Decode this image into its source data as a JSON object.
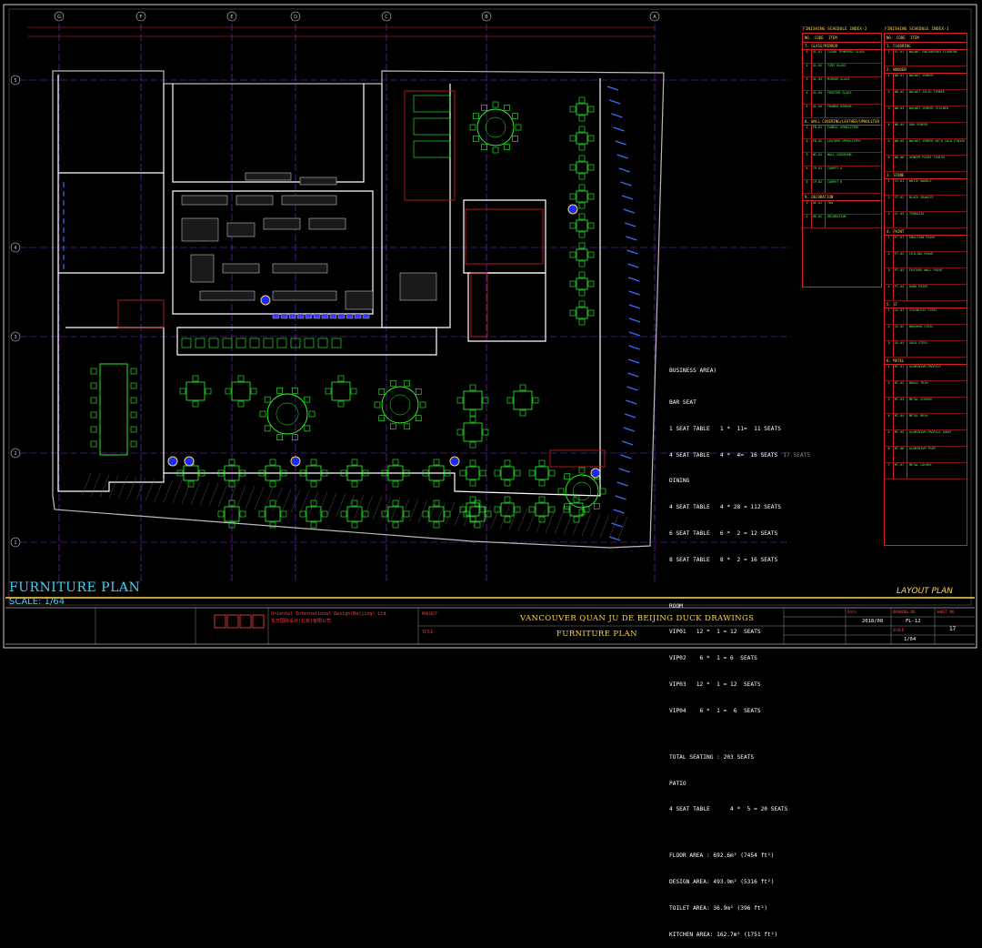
{
  "sheet": {
    "title": "FURNITURE PLAN",
    "scale": "SCALE: 1/64",
    "layout_plan": "LAYOUT PLAN",
    "grid_columns": [
      "G",
      "F",
      "E",
      "D",
      "C",
      "B",
      "A"
    ],
    "grid_rows": [
      "5",
      "4",
      "3",
      "2",
      "1"
    ]
  },
  "stats": {
    "business_area": "BUSINESS AREA)",
    "bar_seat": "BAR SEAT",
    "bar_1": "1 SEAT TABLE   1 *  11=  11 SEATS",
    "bar_4": "4 SEAT TABLE   4 *  4=  16 SEATS",
    "bar_note": "17 SEATS",
    "dining": "DINING",
    "dining_4": "4 SEAT TABLE   4 * 28 = 112 SEATS",
    "dining_6": "6 SEAT TABLE   6 *  2 = 12 SEATS",
    "dining_8": "8 SEAT TABLE   8 *  2 = 16 SEATS",
    "room": "ROOM",
    "vip01": "VIP01   12 *  1 = 12  SEATS",
    "vip02": "VIP02    6 *  1 = 6  SEATS",
    "vip03": "VIP03   12 *  1 = 12  SEATS",
    "vip04": "VIP04    6 *  1 =  6  SEATS",
    "total": "TOTAL SEATING : 203 SEATS",
    "patio": "PATIO",
    "patio_4": "4 SEAT TABLE      4 *  5 = 20 SEATS",
    "floor_area": "FLOOR AREA : 692.6m² (7454 ft²)",
    "design_area": "DESIGN AREA: 493.9m² (5316 ft²)",
    "toilet_area": "TOILET AREA: 36.9m² (396 ft²)",
    "kitchen_area": "KITCHEN AREA: 162.7m² (1751 ft²)"
  },
  "schedule_2": {
    "title": "FINISHING SCHEDULE INDEX-2",
    "col_no": "NO.",
    "col_code": "CODE",
    "col_desc": "ITEM",
    "sections": [
      {
        "name": "7. GLASS/MIRROR",
        "rows": [
          [
            "1",
            "GL-01",
            "CLEAR TEMPERED GLASS"
          ],
          [
            "2",
            "GL-02",
            "TINT GLASS"
          ],
          [
            "3",
            "GL-03",
            "MIRROR GLASS"
          ],
          [
            "4",
            "GL-04",
            "FROSTED GLASS"
          ],
          [
            "5",
            "GL-05",
            "FRAMED MIRROR"
          ]
        ]
      },
      {
        "name": "8. WALL COVERING/LEATHER/UPHOLSTER",
        "rows": [
          [
            "1",
            "FB-01",
            "FABRIC UPHOLSTERY"
          ],
          [
            "2",
            "FB-02",
            "LEATHER UPHOLSTERY"
          ],
          [
            "3",
            "WC-01",
            "WALL COVERING"
          ],
          [
            "4",
            "CP-01",
            "CARPET A"
          ],
          [
            "5",
            "CP-02",
            "CARPET B"
          ]
        ]
      },
      {
        "name": "9. DECORATION",
        "rows": [
          [
            "1",
            "DE-01",
            "TBA"
          ],
          [
            "2",
            "DE-02",
            "DECORATION"
          ]
        ]
      }
    ]
  },
  "schedule_1": {
    "title": "FINISHING SCHEDULE INDEX-1",
    "col_no": "NO.",
    "col_code": "CODE",
    "col_desc": "ITEM",
    "sections": [
      {
        "name": "1. FLOORING",
        "rows": [
          [
            "1",
            "FL-01",
            "WALNUT ENGINEERED FLOORING"
          ]
        ]
      },
      {
        "name": "2. WOODEN",
        "rows": [
          [
            "1",
            "WD-01",
            "WALNUT VENEER"
          ],
          [
            "2",
            "WD-02",
            "WALNUT SOLID TIMBER"
          ],
          [
            "3",
            "WD-03",
            "WALNUT VENEER STAINED"
          ],
          [
            "4",
            "WD-04",
            "OAK VENEER"
          ],
          [
            "5",
            "WD-05",
            "WALNUT VENEER WITH GOLD FINISH"
          ],
          [
            "6",
            "WD-06",
            "VENEER PAINT FINISH"
          ]
        ]
      },
      {
        "name": "3. STONE",
        "rows": [
          [
            "1",
            "ST-01",
            "WHITE MARBLE"
          ],
          [
            "2",
            "ST-02",
            "BLACK GRANITE"
          ],
          [
            "3",
            "ST-03",
            "TERRAZZO"
          ]
        ]
      },
      {
        "name": "4. PAINT",
        "rows": [
          [
            "1",
            "PT-01",
            "EMULSION PAINT"
          ],
          [
            "2",
            "PT-02",
            "CEILING PAINT"
          ],
          [
            "3",
            "PT-03",
            "FEATURE WALL PAINT"
          ],
          [
            "4",
            "PT-04",
            "DARK PAINT"
          ]
        ]
      },
      {
        "name": "5. ST",
        "rows": [
          [
            "1",
            "SS-01",
            "STAINLESS STEEL"
          ],
          [
            "2",
            "SS-02",
            "BRUSHED STEEL"
          ],
          [
            "3",
            "SS-03",
            "GOLD STEEL"
          ]
        ]
      },
      {
        "name": "6. MATEL",
        "rows": [
          [
            "1",
            "MT-01",
            "ALUMINIUM PROFILE"
          ],
          [
            "2",
            "MT-02",
            "BRASS TRIM"
          ],
          [
            "3",
            "MT-03",
            "METAL SCREEN"
          ],
          [
            "4",
            "MT-04",
            "METAL MESH"
          ],
          [
            "5",
            "MT-05",
            "ALUMINIUM PROFILE SHEET"
          ],
          [
            "6",
            "MT-06",
            "ALUMINIUM TRIM"
          ],
          [
            "7",
            "MT-07",
            "METAL LOUVRE"
          ]
        ]
      }
    ]
  },
  "title_block": {
    "company_cn": "Oriental International Design(Beijing) Ltd.",
    "company_cn_2": "东方国际设计(北京)有限公司",
    "project": "VANCOUVER QUAN JU DE BEIJING DUCK  DRAWINGS",
    "drawing": "FURNITURE PLAN",
    "date": "2018/08",
    "scale": "1/64",
    "sheet_no": "FL-12",
    "page": "17",
    "label_project": "PROJECT",
    "label_title": "TITLE",
    "label_date": "Date",
    "label_scale": "SCALE",
    "label_dwg": "DRAWING NO.",
    "label_sheet": "SHEET NO."
  },
  "colors": {
    "grid": "#8a2be2",
    "wall": "#ffffff",
    "table": "#2bff2b",
    "chair": "#2bff2b",
    "window": "#3a6cff",
    "outline": "#d81f26",
    "dim": "#ffd84a",
    "cyan": "#3dd5ff"
  }
}
